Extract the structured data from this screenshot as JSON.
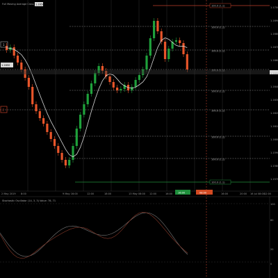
{
  "header": {
    "symbol_text": "Full Moving Average Cross 2, 5",
    "price_box": "1.1650"
  },
  "colors": {
    "background": "#000000",
    "bull": "#1fa13b",
    "bear": "#e8552a",
    "grid": "#2a2a2a",
    "level_line": "#8a8a8a",
    "ma_line": "#d8d8d8",
    "signal_line": "#8a3a2a",
    "indicator_line": "#7a7a7a",
    "price_tag_bg": "#d9d9d9",
    "green_tag_bg": "#1f8f3c",
    "red_tag_bg": "#d34a22",
    "vline": "#c0402a"
  },
  "fib_labels": [
    "100.0 (1.1)",
    "100.0 (1.1)",
    "100.0 (1.1)",
    "100.0 (1.1)",
    "100.0 (1.1)",
    "100.0 (1.1)",
    "100.0 (1.1)",
    "100.0 (1.1)",
    "100.0 (1.1)"
  ],
  "price_scale": [
    "1.1700",
    "1.1690",
    "1.1680",
    "1.1670",
    "1.1660",
    "1.1650",
    "1.1640",
    "1.1630",
    "1.1620",
    "1.1610",
    "1.1600",
    "1.1590",
    "1.1580",
    "1.1570"
  ],
  "time_labels": [
    "2 May 2019",
    "8:00",
    "9 May 16:00",
    "12:00",
    "18:00",
    "13 May 08:00",
    "12:00",
    "16:00",
    "16:00",
    "20:00",
    "16 Jul 08:00",
    "12:00"
  ],
  "time_tags": {
    "green": "16:00",
    "red": "08:00"
  },
  "left_tags": {
    "box_1": "1",
    "box_2": "2",
    "price_label": "1.1650"
  },
  "indicator": {
    "title": "Stochastic Oscillator (14, 3, 3) Value: 78, 71",
    "scale": [
      "100",
      "80",
      "20",
      "0"
    ]
  }
}
